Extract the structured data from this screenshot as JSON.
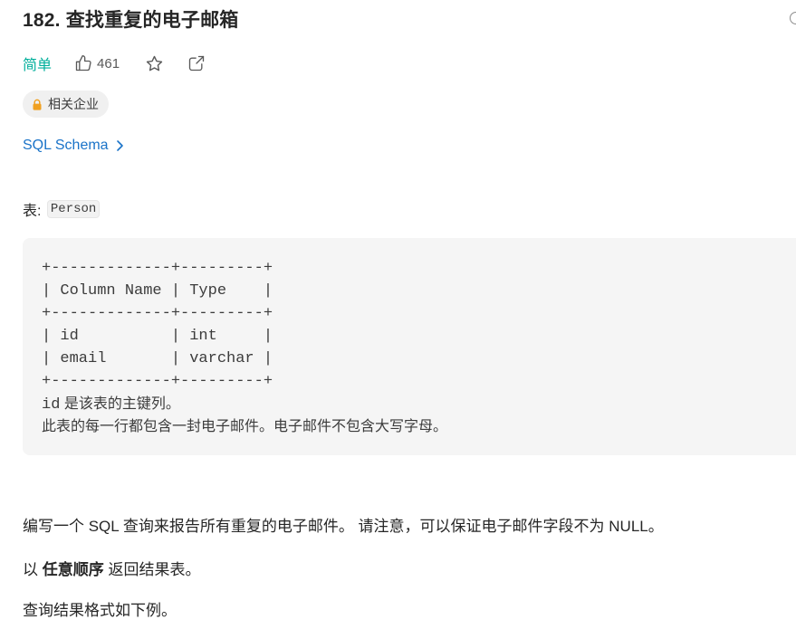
{
  "problem": {
    "title": "182. 查找重复的电子邮箱",
    "difficulty": "简单",
    "likes": "461",
    "colors": {
      "difficulty": "#00af9b",
      "link": "#1a73c8"
    },
    "icons": [
      "thumbs-up-icon",
      "star-icon",
      "share-icon",
      "lock-icon",
      "chevron-right-icon"
    ]
  },
  "tag": {
    "label": "相关企业"
  },
  "schema": {
    "label": "SQL Schema"
  },
  "table_intro": {
    "prefix": "表: ",
    "name": "Person"
  },
  "code_block": {
    "lines": [
      "+-------------+---------+",
      "| Column Name | Type    |",
      "+-------------+---------+",
      "| id          | int     |",
      "| email       | varchar |",
      "+-------------+---------+"
    ],
    "note1_code": "id",
    "note1_text": " 是该表的主键列。",
    "note2": "此表的每一行都包含一封电子邮件。电子邮件不包含大写字母。"
  },
  "description": {
    "p1": "编写一个 SQL 查询来报告所有重复的电子邮件。 请注意，可以保证电子邮件字段不为 NULL。",
    "p2_prefix": "以 ",
    "p2_bold": "任意顺序",
    "p2_suffix": " 返回结果表。",
    "p3": "查询结果格式如下例。"
  }
}
